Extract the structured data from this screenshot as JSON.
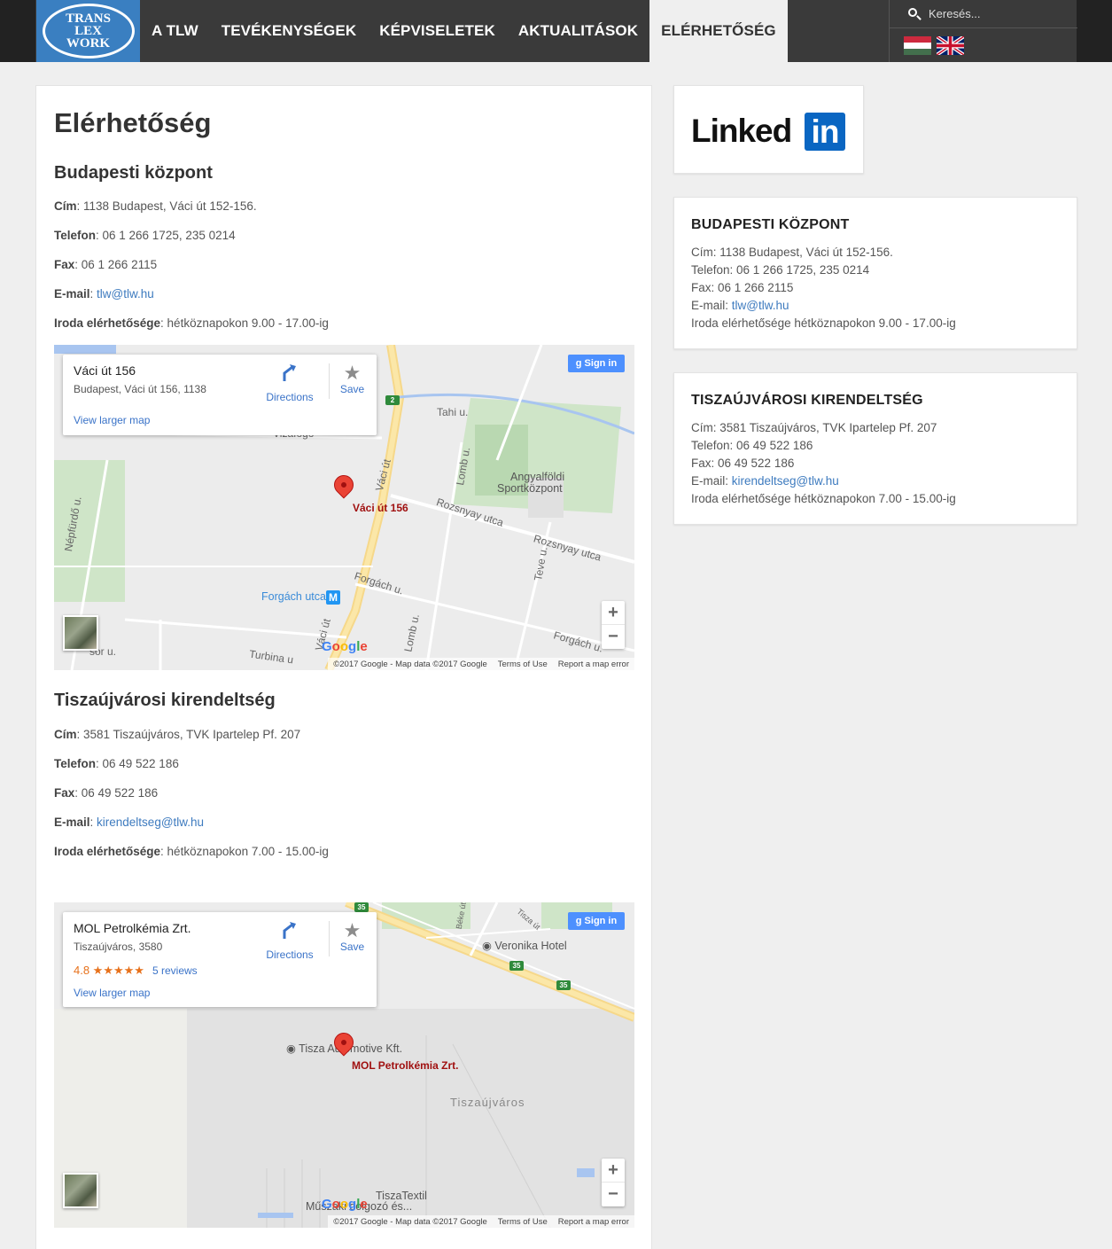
{
  "logo": {
    "line1": "TRANS",
    "line2": "LEX",
    "line3": "WORK"
  },
  "nav": {
    "items": [
      "A TLW",
      "TEVÉKENYSÉGEK",
      "KÉPVISELETEK",
      "AKTUALITÁSOK",
      "ELÉRHETŐSÉG"
    ],
    "active": "ELÉRHETŐSÉG"
  },
  "search": {
    "placeholder": "Keresés..."
  },
  "main": {
    "title": "Elérhetőség",
    "budapest": {
      "heading": "Budapesti központ",
      "address_label": "Cím",
      "address": ": 1138 Budapest, Váci út 152-156.",
      "phone_label": "Telefon",
      "phone": ": 06 1 266 1725, 235 0214",
      "fax_label": "Fax",
      "fax": ": 06 1 266 2115",
      "email_label": "E-mail",
      "email_sep": ": ",
      "email": "tlw@tlw.hu",
      "hours_label": "Iroda elérhetősége",
      "hours": ": hétköznapokon 9.00 - 17.00-ig"
    },
    "tiszaujvaros": {
      "heading": "Tiszaújvárosi kirendeltség",
      "address_label": "Cím",
      "address": ": 3581 Tiszaújváros, TVK Ipartelep Pf. 207",
      "phone_label": "Telefon",
      "phone": ": 06 49 522 186",
      "fax_label": "Fax",
      "fax": ": 06 49 522 186",
      "email_label": "E-mail",
      "email_sep": ": ",
      "email": "kirendeltseg@tlw.hu",
      "hours_label": "Iroda elérhetősége",
      "hours": ": hétköznapokon 7.00 - 15.00-ig"
    }
  },
  "map1": {
    "place_title": "Váci út 156",
    "place_address": "Budapest, Váci út 156, 1138",
    "directions": "Directions",
    "save": "Save",
    "larger_map": "View larger map",
    "signin": "Sign in",
    "marker_label": "Váci út 156",
    "labels": {
      "vaci_ut": "Váci út",
      "vaci_ut2": "Váci út",
      "tahi": "Tahi u.",
      "lomb": "Lomb u.",
      "lomb2": "Lomb u.",
      "angyal1": "Angyalföldi",
      "angyal2": "Sportközpont",
      "rozsnyay1": "Rozsnyay utca",
      "rozsnyay2": "Rozsnyay utca",
      "forgach1": "Forgách u.",
      "forgach2": "Forgách u.",
      "teve": "Teve u.",
      "strand": "Népfürdő u.",
      "turbina": "Turbina u",
      "metro_stop": "Forgách utca",
      "vizafogo": "Vizafogó",
      "sor": "sor u.",
      "road2": "2"
    },
    "footer": {
      "copyright": "©2017 Google - Map data ©2017 Google",
      "terms": "Terms of Use",
      "report": "Report a map error"
    }
  },
  "map2": {
    "place_title": "MOL Petrolkémia Zrt.",
    "place_address": "Tiszaújváros, 3580",
    "rating": "4.8 ★★★★★",
    "reviews": "5 reviews",
    "directions": "Directions",
    "save": "Save",
    "larger_map": "View larger map",
    "signin": "Sign in",
    "marker_label": "MOL Petrolkémia Zrt.",
    "labels": {
      "veronika": "Veronika Hotel",
      "tisza_auto": "Tisza Automotive Kft.",
      "tiszaujvaros": "Tiszaújváros",
      "tiszatextil1": "TiszaTextil",
      "tiszatextil2": "Műszaki dolgozó és...",
      "beke": "Béke út",
      "tisza_ut": "Tisza út",
      "road35a": "35",
      "road35b": "35",
      "road35c": "35"
    },
    "footer": {
      "copyright": "©2017 Google - Map data ©2017 Google",
      "terms": "Terms of Use",
      "report": "Report a map error"
    }
  },
  "sidebar": {
    "linkedin_text": "Linked",
    "linkedin_in": "in",
    "budapest": {
      "title": "BUDAPESTI KÖZPONT",
      "address": "Cím: 1138 Budapest, Váci út 152-156.",
      "phone": "Telefon: 06 1 266 1725, 235 0214",
      "fax": "Fax: 06 1 266 2115",
      "email_label": "E-mail: ",
      "email": "tlw@tlw.hu",
      "hours": "Iroda elérhetősége hétköznapokon 9.00 - 17.00-ig"
    },
    "tiszaujvaros": {
      "title": "TISZAÚJVÁROSI KIRENDELTSÉG",
      "address": "Cím: 3581 Tiszaújváros, TVK Ipartelep Pf. 207",
      "phone": "Telefon: 06 49 522 186",
      "fax": "Fax: 06 49 522 186",
      "email_label": "E-mail: ",
      "email": "kirendeltseg@tlw.hu",
      "hours": "Iroda elérhetősége hétköznapokon 7.00 - 15.00-ig"
    }
  },
  "colors": {
    "accent": "#3a7fc1",
    "link": "#3e7bbf",
    "topbar": "#3a3a3a",
    "background": "#efefef"
  },
  "icons": [
    "search-icon",
    "hungarian-flag-icon",
    "english-flag-icon",
    "directions-icon",
    "star-icon",
    "map-pin-icon",
    "metro-icon"
  ]
}
